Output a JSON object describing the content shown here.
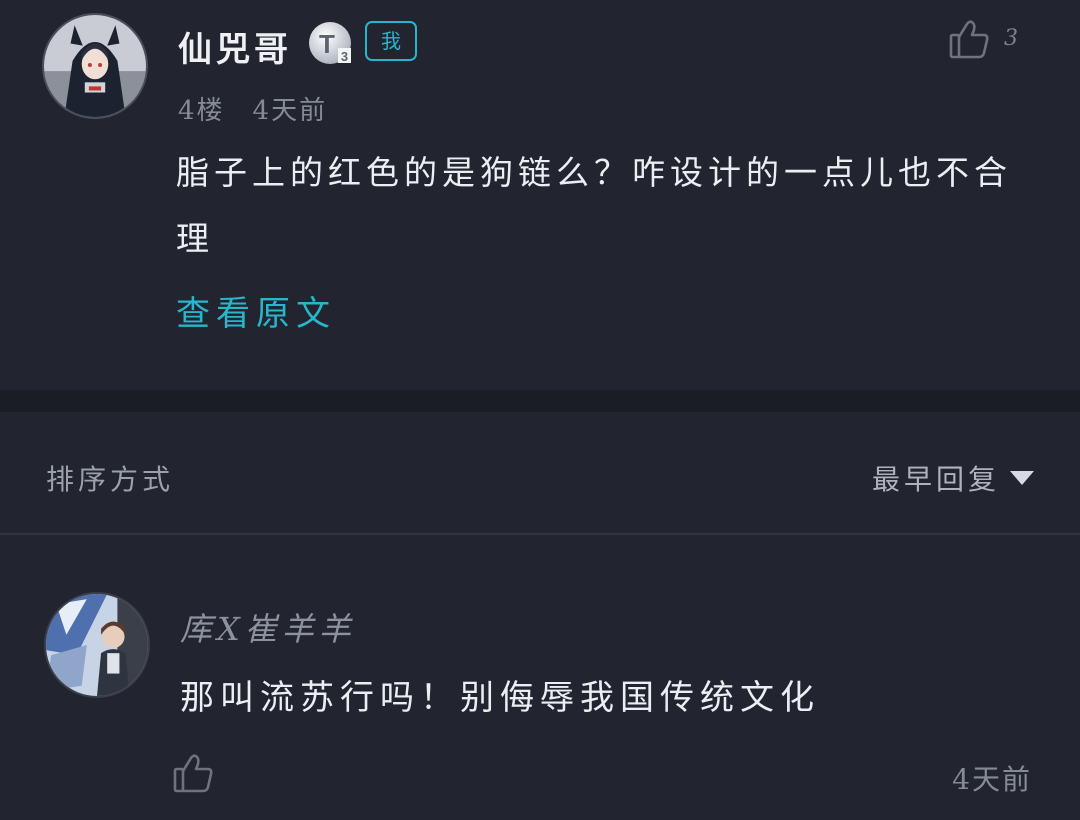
{
  "comment": {
    "username": "仙兕哥",
    "level_badge": "T",
    "level_sub": "3",
    "me_tag": "我",
    "like_count": "3",
    "floor": "4楼",
    "time": "4天前",
    "text": "脂子上的红色的是狗链么？咋设计的一点儿也不合理",
    "view_original": "查看原文"
  },
  "sort": {
    "label": "排序方式",
    "selected": "最早回复"
  },
  "reply": {
    "username": "库X崔羊羊",
    "text": "那叫流苏行吗！别侮辱我国传统文化",
    "time": "4天前"
  },
  "colors": {
    "background": "#22252f",
    "accent": "#27b6cc",
    "divider": "#1b1d25"
  },
  "icons": [
    "thumbs-up-icon",
    "level-badge-icon",
    "chevron-down-icon"
  ]
}
